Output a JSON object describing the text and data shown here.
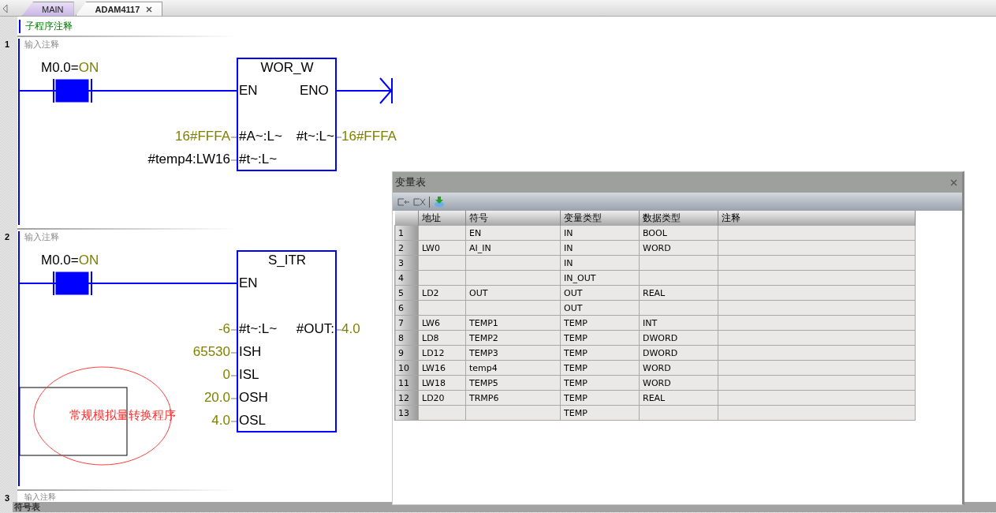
{
  "tabs": [
    {
      "label": "MAIN",
      "selected": false,
      "closable": false
    },
    {
      "label": "ADAM4117",
      "selected": true,
      "closable": true
    }
  ],
  "subroutine_comment": "子程序注释",
  "networks": [
    {
      "number": "1",
      "comment": "输入注释",
      "contact": {
        "operand": "M0.0=",
        "state": "ON",
        "energized": true
      },
      "block": {
        "title": "WOR_W",
        "en": "EN",
        "eno": "ENO",
        "inputs": [
          {
            "value": "16#FFFA",
            "kind": "constant",
            "pin": "#A~:L~"
          },
          {
            "value": "#temp4:LW16",
            "kind": "variable",
            "pin": "#t~:L~"
          }
        ],
        "outputs": [
          {
            "pin": "#t~:L~",
            "value": "16#FFFA"
          }
        ]
      }
    },
    {
      "number": "2",
      "comment": "输入注释",
      "contact": {
        "operand": "M0.0=",
        "state": "ON",
        "energized": true
      },
      "block": {
        "title": "S_ITR",
        "en": "EN",
        "inputs": [
          {
            "value": "-6",
            "kind": "constant",
            "pin": "#t~:L~"
          },
          {
            "value": "65530",
            "kind": "constant",
            "pin": "ISH"
          },
          {
            "value": "0",
            "kind": "constant",
            "pin": "ISL"
          },
          {
            "value": "20.0",
            "kind": "constant",
            "pin": "OSH"
          },
          {
            "value": "4.0",
            "kind": "constant",
            "pin": "OSL"
          }
        ],
        "outputs": [
          {
            "pin": "#OUT:",
            "value": "4.0"
          }
        ]
      },
      "annotation": {
        "text": "常规模拟量转换程序"
      }
    },
    {
      "number": "3",
      "comment": "输入注释"
    }
  ],
  "variable_table": {
    "title": "变量表",
    "columns": [
      "地址",
      "符号",
      "变量类型",
      "数据类型",
      "注释"
    ],
    "rows": [
      {
        "number": "1",
        "symbol": "EN",
        "var_type": "IN",
        "data_type": "BOOL"
      },
      {
        "number": "2",
        "address": "LW0",
        "symbol": "AI_IN",
        "var_type": "IN",
        "data_type": "WORD"
      },
      {
        "number": "3",
        "var_type": "IN"
      },
      {
        "number": "4",
        "var_type": "IN_OUT"
      },
      {
        "number": "5",
        "address": "LD2",
        "symbol": "OUT",
        "var_type": "OUT",
        "data_type": "REAL"
      },
      {
        "number": "6",
        "var_type": "OUT"
      },
      {
        "number": "7",
        "address": "LW6",
        "symbol": "TEMP1",
        "var_type": "TEMP",
        "data_type": "INT"
      },
      {
        "number": "8",
        "address": "LD8",
        "symbol": "TEMP2",
        "var_type": "TEMP",
        "data_type": "DWORD"
      },
      {
        "number": "9",
        "address": "LD12",
        "symbol": "TEMP3",
        "var_type": "TEMP",
        "data_type": "DWORD"
      },
      {
        "number": "10",
        "address": "LW16",
        "symbol": "temp4",
        "var_type": "TEMP",
        "data_type": "WORD"
      },
      {
        "number": "11",
        "address": "LW18",
        "symbol": "TEMP5",
        "var_type": "TEMP",
        "data_type": "WORD"
      },
      {
        "number": "12",
        "address": "LD20",
        "symbol": "TRMP6",
        "var_type": "TEMP",
        "data_type": "REAL"
      },
      {
        "number": "13",
        "var_type": "TEMP"
      }
    ]
  },
  "bottom_panel": {
    "title": "符号表"
  }
}
